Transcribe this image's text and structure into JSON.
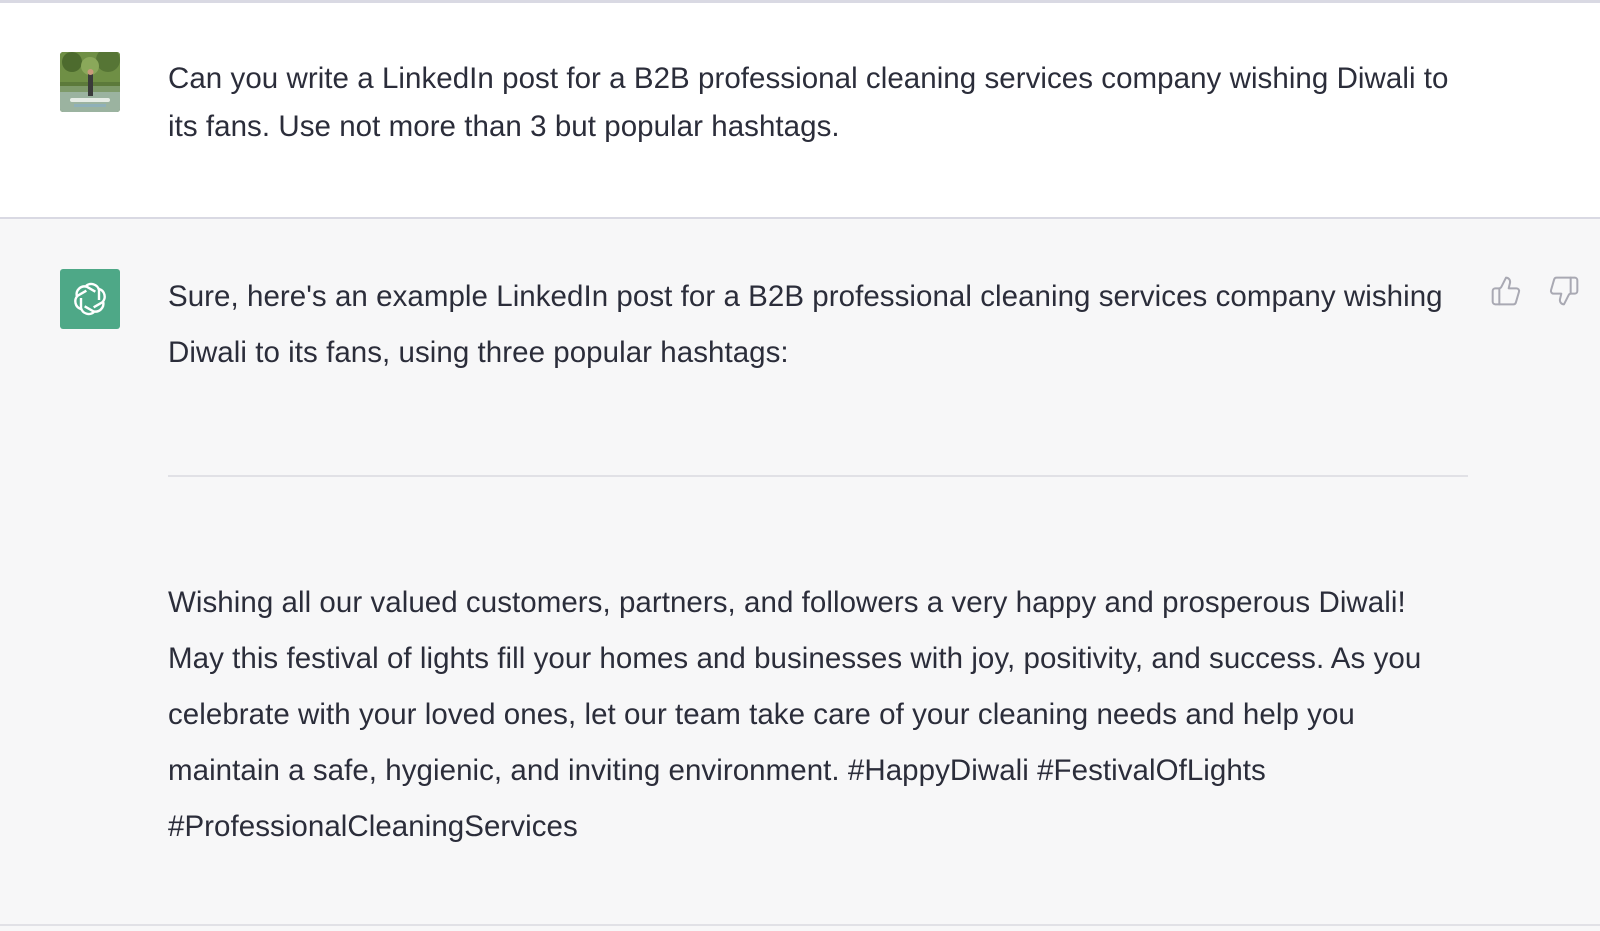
{
  "conversation": {
    "user_message": {
      "avatar": "user-photo-avatar",
      "text": "Can you write a LinkedIn post for a B2B professional cleaning services company wishing Diwali to its fans. Use not more than 3 but popular hashtags."
    },
    "assistant_message": {
      "avatar": "openai-logo-icon",
      "intro": "Sure, here's an example LinkedIn post for a B2B professional cleaning services company wishing Diwali to its fans, using three popular hashtags:",
      "post": "Wishing all our valued customers, partners, and followers a very happy and prosperous Diwali! May this festival of lights fill your homes and businesses with joy, positivity, and success. As you celebrate with your loved ones, let our team take care of your cleaning needs and help you maintain a safe, hygienic, and inviting environment. #HappyDiwali #FestivalOfLights #ProfessionalCleaningServices",
      "feedback": {
        "like_icon": "thumbs-up-icon",
        "dislike_icon": "thumbs-down-icon"
      }
    }
  },
  "colors": {
    "assistant_bg": "#f7f7f8",
    "user_bg": "#ffffff",
    "bot_avatar": "#4ea887",
    "text": "#2b2d3a"
  }
}
